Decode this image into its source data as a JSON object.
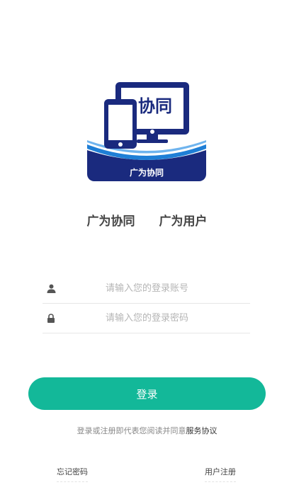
{
  "logo": {
    "text_main": "协同",
    "text_banner": "广为协同",
    "colors": {
      "navy": "#1a2a7e",
      "blue_swoosh": "#1f7fd6",
      "white": "#ffffff"
    }
  },
  "tabs": [
    {
      "label": "广为协同"
    },
    {
      "label": "广为用户"
    }
  ],
  "form": {
    "account": {
      "placeholder": "请输入您的登录账号",
      "value": "",
      "icon": "person-icon"
    },
    "password": {
      "placeholder": "请输入您的登录密码",
      "value": "",
      "icon": "lock-icon"
    }
  },
  "login_button": {
    "label": "登录",
    "color": "#13b899"
  },
  "agreement": {
    "prefix": "登录或注册即代表您阅读并同意",
    "link": "服务协议"
  },
  "footer": {
    "forgot": "忘记密码",
    "register": "用户注册"
  }
}
